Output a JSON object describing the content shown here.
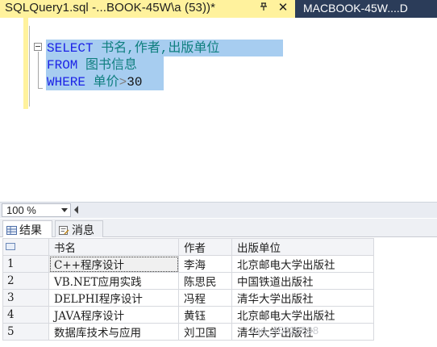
{
  "tabs": {
    "active_title": "SQLQuery1.sql -...BOOK-45W\\a (53))*",
    "pin_icon": "pin-icon",
    "close_icon": "close-icon",
    "inactive_title": "MACBOOK-45W....D"
  },
  "editor": {
    "line1": {
      "keyword": "SELECT",
      "columns": "书名,作者,出版单位"
    },
    "line2": {
      "keyword": "FROM",
      "table": "图书信息"
    },
    "line3": {
      "keyword": "WHERE",
      "column": "单价",
      "operator": ">",
      "value": "30"
    },
    "colors": {
      "keyword": "#1c23e6",
      "identifier": "#0f7f7f",
      "selection": "#a7cdf0",
      "margin": "#fff29d"
    }
  },
  "zoom": {
    "value": "100 %"
  },
  "results_tabs": [
    {
      "label": "结果",
      "icon": "grid-icon"
    },
    {
      "label": "消息",
      "icon": "message-icon"
    }
  ],
  "grid": {
    "columns": [
      "书名",
      "作者",
      "出版单位"
    ],
    "rows": [
      {
        "num": "1",
        "cells": [
          "C++程序设计",
          "李海",
          "北京邮电大学出版社"
        ]
      },
      {
        "num": "2",
        "cells": [
          "VB.NET应用实践",
          "陈思民",
          "中国铁道出版社"
        ]
      },
      {
        "num": "3",
        "cells": [
          "DELPHI程序设计",
          "冯程",
          "清华大学出版社"
        ]
      },
      {
        "num": "4",
        "cells": [
          "JAVA程序设计",
          "黄钰",
          "北京邮电大学出版社"
        ]
      },
      {
        "num": "5",
        "cells": [
          "数据库技术与应用",
          "刘卫国",
          "清华大学出版社"
        ]
      }
    ]
  },
  "watermark": "/qq_45828598"
}
